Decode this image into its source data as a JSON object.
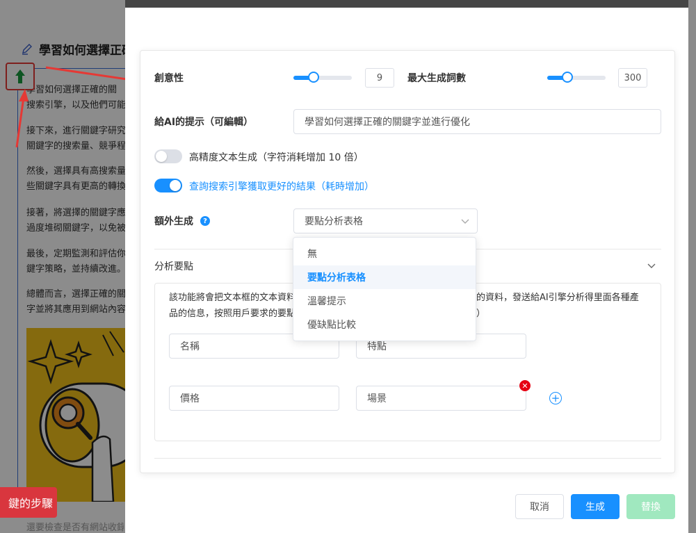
{
  "background": {
    "title": "學習如何選擇正確",
    "paragraphs": [
      [
        "學習如何選擇正確的關",
        "搜索引擎，以及他們可能"
      ],
      [
        "接下來，進行關鍵字研究",
        "關鍵字的搜索量、競爭程"
      ],
      [
        "然後，選擇具有高搜索量",
        "些關鍵字具有更高的轉換"
      ],
      [
        "接著，將選擇的關鍵字應",
        "過度堆砌關鍵字，以免被"
      ],
      [
        "最後，定期監測和評估你",
        "鍵字策略，並持續改進。"
      ],
      [
        "總體而言，選擇正確的關",
        "字並將其應用到網站內容"
      ]
    ],
    "red_button_label": "鍵的步驟",
    "bottom_text": "還要檢查是否有網站收錄"
  },
  "form": {
    "creativity_label": "創意性",
    "creativity_value": "9",
    "creativity_level": 0.35,
    "max_words_label": "最大生成詞數",
    "max_words_value": "300",
    "max_words_level": 0.35,
    "prompt_label": "給AI的提示（可編輯）",
    "prompt_value": "學習如何選擇正確的關鍵字並進行優化",
    "high_precision_label": "高精度文本生成（字符消耗增加 10 倍）",
    "search_label": "查詢搜索引擎獲取更好的結果（耗時增加）",
    "extra_label": "額外生成",
    "extra_selected": "要點分析表格",
    "extra_options": [
      "無",
      "要點分析表格",
      "溫馨提示",
      "優缺點比較"
    ],
    "analysis_title": "分析要點",
    "analysis_desc_line1_left": "該功能將會把文本框的文本資料",
    "analysis_desc_line1_right": "的資料，發送給AI引擎分析得里面各種產",
    "analysis_desc_line2_left": "品的信息，按照用戶要求的要點",
    "analysis_desc_line2_right": "）",
    "fields": [
      "名稱",
      "特點",
      "價格",
      "場景"
    ],
    "remove_glyph": "✕",
    "add_glyph": "+"
  },
  "footer": {
    "cancel_label": "取消",
    "generate_label": "生成",
    "replace_label": "替換"
  },
  "colors": {
    "accent": "#1890ff",
    "disabled_green": "#a0e8bf",
    "danger": "#e60012"
  }
}
